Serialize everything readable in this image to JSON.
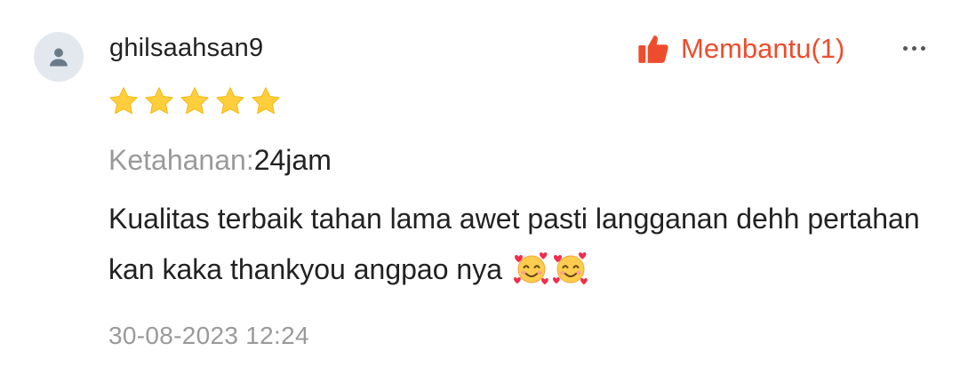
{
  "review": {
    "username": "ghilsaahsan9",
    "rating": 5,
    "helpful_label": "Membantu(1)",
    "durability_label": "Ketahanan:",
    "durability_value": "24jam",
    "comment": "Kualitas terbaik tahan lama awet pasti langganan dehh pertahan kan kaka thankyou angpao nya",
    "comment_emoji": [
      "smiling-face-with-hearts",
      "smiling-face-with-hearts"
    ],
    "timestamp": "30-08-2023 12:24"
  },
  "colors": {
    "accent": "#ee4d2d",
    "star": "#ffce3d",
    "muted_text": "#9a9a9a",
    "avatar_bg": "#e3e8ee"
  },
  "icons": {
    "avatar": "user-silhouette-icon",
    "helpful": "thumbs-up-icon",
    "more": "more-dots-icon",
    "star": "star-icon"
  }
}
